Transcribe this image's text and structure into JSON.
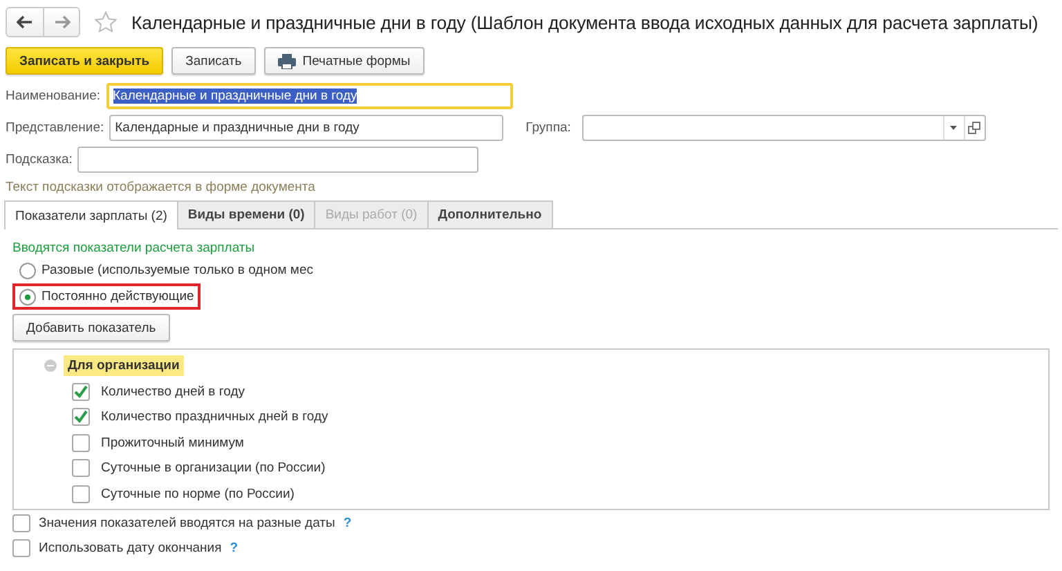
{
  "title": "Календарные и праздничные дни в году (Шаблон документа ввода исходных данных для расчета зарплаты)",
  "toolbar": [
    {
      "label": "Записать и закрыть",
      "kind": "primary"
    },
    {
      "label": "Записать",
      "kind": "plain"
    },
    {
      "label": "Печатные формы",
      "kind": "print"
    }
  ],
  "fields": {
    "name": {
      "label": "Наименование:",
      "value": "Календарные и праздничные дни в году",
      "focused": true
    },
    "presentation": {
      "label": "Представление:",
      "value": "Календарные и праздничные дни в году"
    },
    "group": {
      "label": "Группа:"
    },
    "hint": {
      "label": "Подсказка:"
    }
  },
  "hint_note": "Текст подсказки отображается в форме документа",
  "tabs": [
    {
      "label": "Показатели зарплаты (2)",
      "selected": true,
      "disabled": false
    },
    {
      "label": "Виды времени (0)",
      "selected": false,
      "disabled": false
    },
    {
      "label": "Виды работ (0)",
      "selected": false,
      "disabled": true
    },
    {
      "label": "Дополнительно",
      "selected": false,
      "disabled": false
    }
  ],
  "caption": "Вводятся показатели расчета зарплаты",
  "radios": [
    {
      "label": "Разовые (используемые только в одном мес",
      "selected": false,
      "highlighted": false
    },
    {
      "label": "Постоянно действующие",
      "selected": true,
      "highlighted": true
    }
  ],
  "add_button": "Добавить показатель",
  "tree": {
    "label": "Для организации",
    "expanded": true,
    "selected": true,
    "children": [
      {
        "label": "Количество дней в году",
        "checked": true
      },
      {
        "label": "Количество праздничных дней в году",
        "checked": true
      },
      {
        "label": "Прожиточный минимум",
        "checked": false
      },
      {
        "label": "Суточные в организации (по России)",
        "checked": false
      },
      {
        "label": "Суточные по норме (по России)",
        "checked": false
      }
    ]
  },
  "options": [
    {
      "label": "Значения показателей вводятся на разные даты",
      "checked": false,
      "help": "?"
    },
    {
      "label": "Использовать дату окончания",
      "checked": false,
      "help": "?"
    }
  ]
}
